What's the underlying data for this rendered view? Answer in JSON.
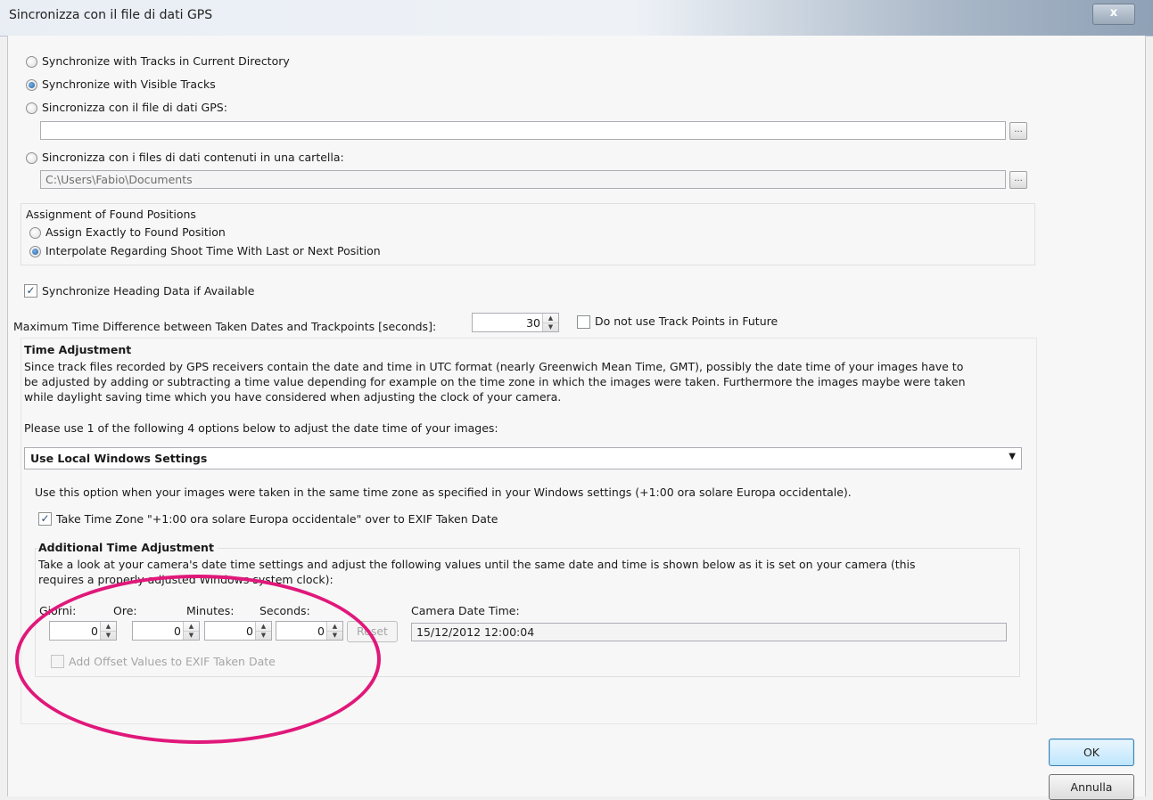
{
  "window": {
    "title": "Sincronizza con il file di dati GPS",
    "close_label": "x"
  },
  "sync_options": {
    "current_directory": "Synchronize with Tracks in Current Directory",
    "visible_tracks": "Synchronize with Visible Tracks",
    "gps_file": "Sincronizza con il file di dati GPS:",
    "gps_file_path": "",
    "folder": "Sincronizza con i files di dati contenuti in una cartella:",
    "folder_path": "C:\\Users\\Fabio\\Documents",
    "selected": "visible_tracks",
    "browse_label": "..."
  },
  "assignment": {
    "title": "Assignment of Found Positions",
    "exact": "Assign Exactly to Found Position",
    "interpolate": "Interpolate Regarding Shoot Time With Last or Next Position",
    "selected": "interpolate"
  },
  "heading": {
    "label": "Synchronize Heading Data if Available",
    "checked": true
  },
  "max_time": {
    "label": "Maximum Time Difference between Taken Dates and Trackpoints [seconds]:",
    "value": "30",
    "future_label": "Do not use Track Points in Future",
    "future_checked": false
  },
  "time_adjustment": {
    "title": "Time Adjustment",
    "desc_line1": "Since track files recorded by GPS receivers contain the date and time in UTC format (nearly Greenwich Mean Time, GMT), possibly the date time of your images have to",
    "desc_line2": "be adjusted by adding or subtracting a time value depending for example on the time zone in which the images were taken. Furthermore the images maybe were taken",
    "desc_line3": "while daylight saving time which you have considered when adjusting the clock of your camera.",
    "options_prompt": "Please use 1 of the following 4 options below to adjust the date time of your images:",
    "selected_option": "Use Local Windows Settings",
    "option_desc": "Use this option when your images were taken in the same time zone as specified in your Windows settings (+1:00 ora solare Europa occidentale).",
    "timezone_check_label": "Take Time Zone \"+1:00 ora solare Europa occidentale\" over to EXIF Taken Date",
    "timezone_checked": true
  },
  "additional": {
    "title": "Additional Time Adjustment",
    "desc_line1": "Take a look at your camera's date time settings and adjust the following values until the same date and time is shown below as it is  set on your camera (this",
    "desc_line2": "requires a properly adjusted Windows system clock):",
    "days_label": "Giorni:",
    "hours_label": "Ore:",
    "minutes_label": "Minutes:",
    "seconds_label": "Seconds:",
    "days": "0",
    "hours": "0",
    "minutes": "0",
    "seconds": "0",
    "reset_label": "Reset",
    "camera_time_label": "Camera Date Time:",
    "camera_time": "15/12/2012 12:00:04",
    "offset_label": "Add Offset Values to EXIF Taken Date",
    "offset_checked": false
  },
  "buttons": {
    "ok": "OK",
    "cancel": "Annulla"
  },
  "colors": {
    "highlight_circle": "#e0187a",
    "default_button_border": "#3c7fb1"
  }
}
